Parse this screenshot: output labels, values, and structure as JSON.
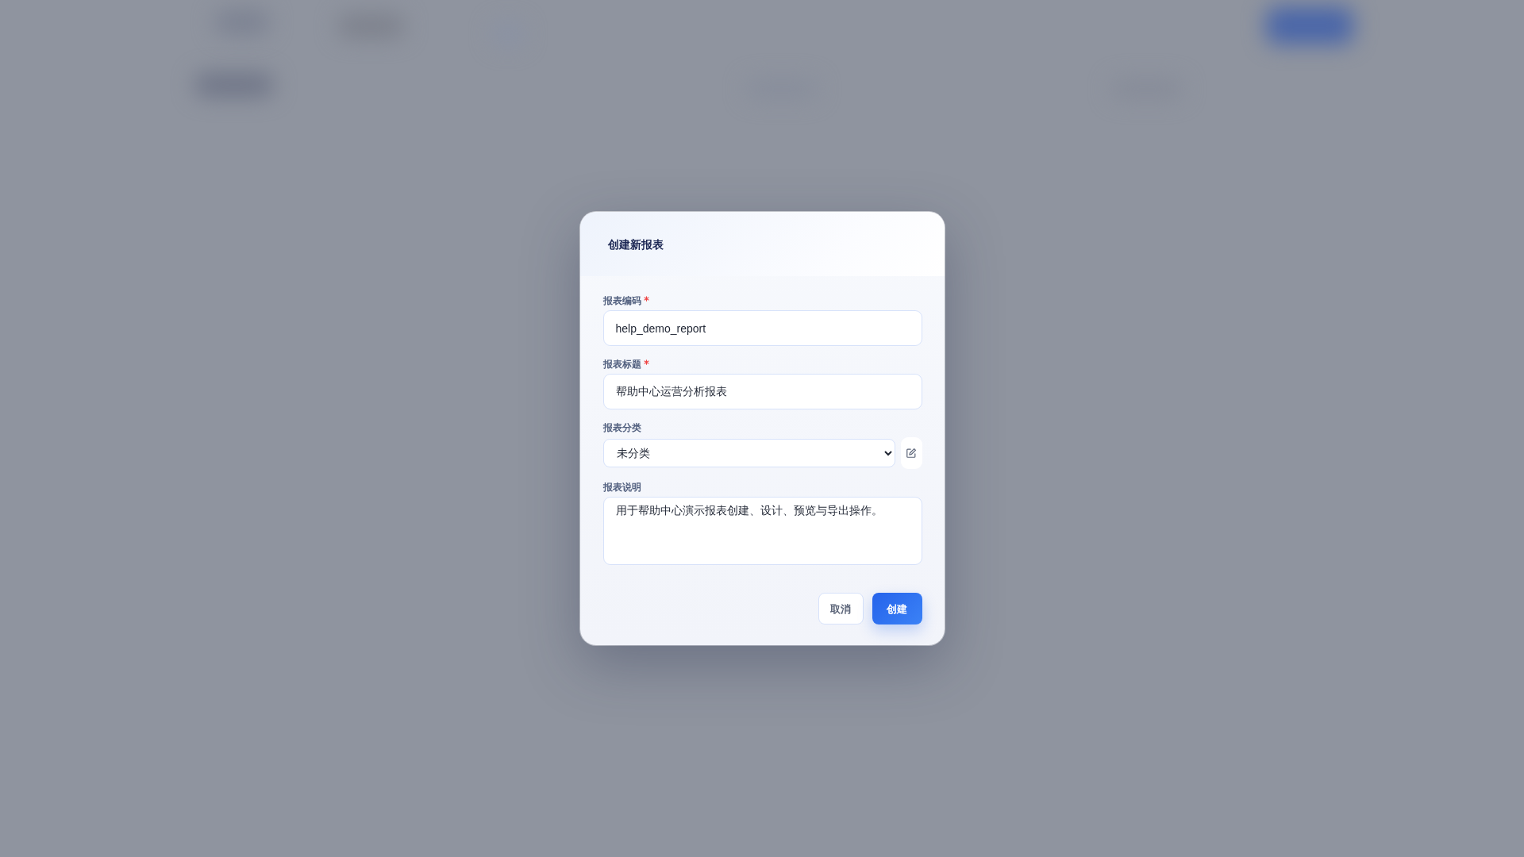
{
  "dialog": {
    "title": "创建新报表",
    "fields": [
      {
        "kind": "input",
        "label": "报表编码",
        "required": true,
        "value": "help_demo_report"
      },
      {
        "kind": "input",
        "label": "报表标题",
        "required": true,
        "value": "帮助中心运营分析报表"
      },
      {
        "kind": "select",
        "label": "报表分类",
        "required": false,
        "value": "未分类"
      },
      {
        "kind": "textarea",
        "label": "报表说明",
        "required": false,
        "value": "用于帮助中心演示报表创建、设计、预览与导出操作。"
      }
    ],
    "buttons": [
      {
        "label": "取消",
        "kind": "secondary"
      },
      {
        "label": "创建",
        "kind": "primary"
      }
    ]
  }
}
